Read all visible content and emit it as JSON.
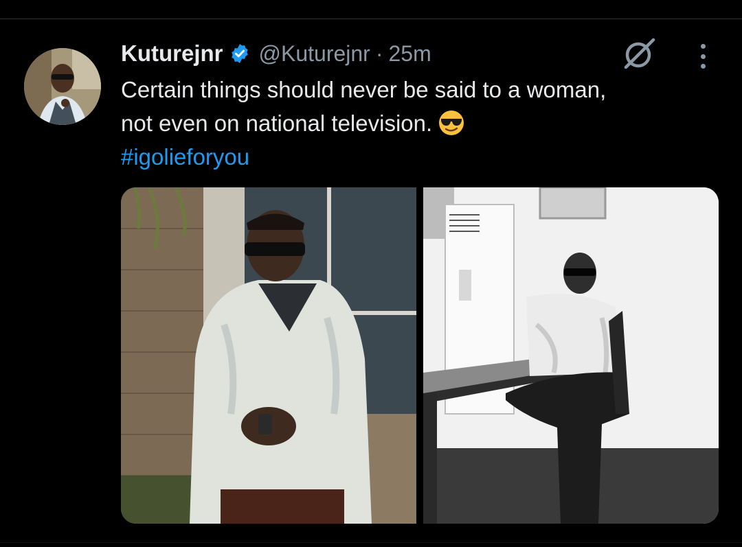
{
  "tweet": {
    "author_name": "Kuturejnr",
    "author_handle": "@Kuturejnr",
    "separator": "·",
    "time_ago": "25m",
    "text_line1": "Certain things should never be said to a woman,",
    "text_line2": "not even on national television.",
    "emoji": "😎",
    "hashtag": "#igolieforyou",
    "verified": true,
    "media_count": 2
  },
  "icons": {
    "verified": "verified-badge-icon",
    "grok": "grok-icon",
    "more": "more-options-icon"
  },
  "colors": {
    "background": "#000000",
    "text": "#e7e9ea",
    "secondary": "#8b98a5",
    "link": "#1d9bf0",
    "verified": "#1d9bf0"
  }
}
